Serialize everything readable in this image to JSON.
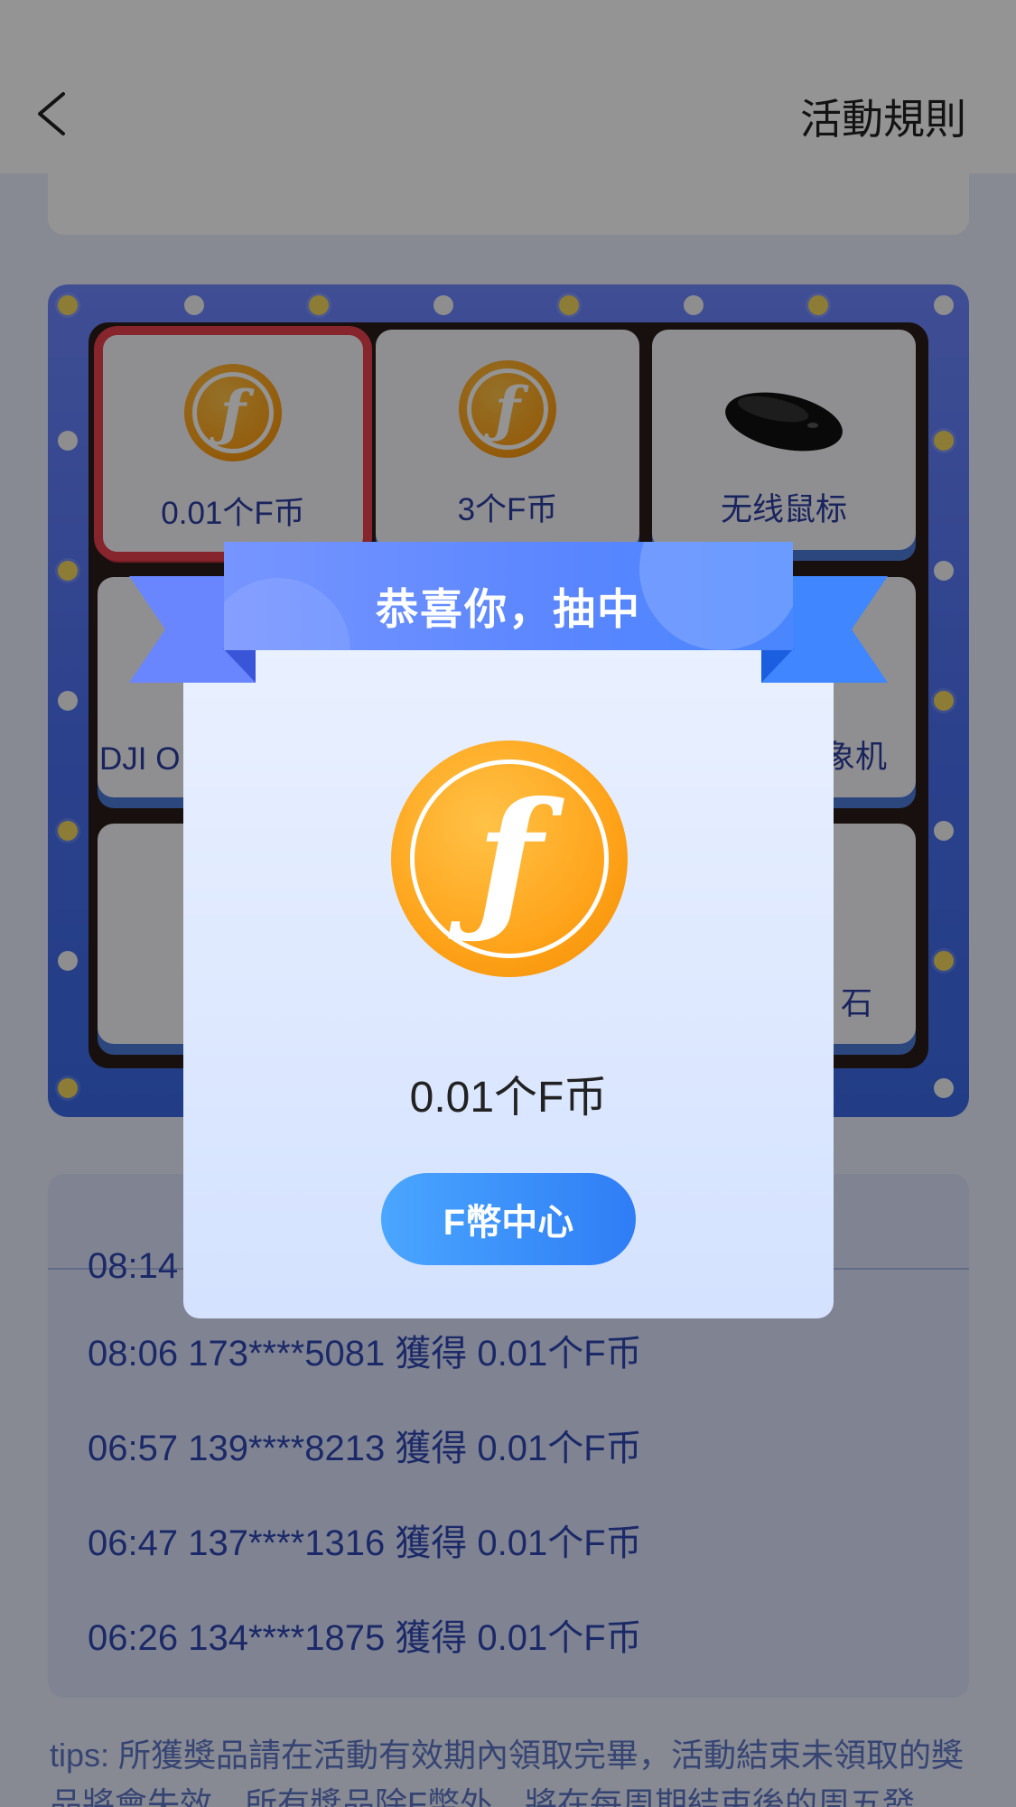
{
  "nav": {
    "rules_label": "活動規則"
  },
  "board": {
    "prizes": [
      {
        "label": "0.01个F币",
        "icon": "coin-icon",
        "active": true
      },
      {
        "label": "3个F币",
        "icon": "coin-icon"
      },
      {
        "label": "无线鼠标",
        "icon": "mouse-icon"
      },
      {
        "label": "DJI O",
        "icon": ""
      },
      {
        "label": "象机",
        "icon": ""
      },
      {
        "label": "",
        "icon": ""
      },
      {
        "label": "",
        "icon": ""
      },
      {
        "label": "石",
        "icon": ""
      }
    ],
    "coin_symbol": "ƒ"
  },
  "records": {
    "partial_top": "08:14",
    "rows": [
      "08:06 173****5081 獲得 0.01个F币",
      "06:57 139****8213 獲得 0.01个F币",
      "06:47 137****1316 獲得 0.01个F币",
      "06:26 134****1875 獲得 0.01个F币"
    ]
  },
  "tips": {
    "text": "tips: 所獲獎品請在活動有效期內領取完畢，活動結束未領取的獎品將會失效，所有獎品除F幣外，將在每周期結束後的周五發"
  },
  "modal": {
    "title": "恭喜你，抽中",
    "prize_name": "0.01个F币",
    "button_label": "F幣中心"
  },
  "colors": {
    "accent": "#4a86ff",
    "active_border": "#e8404c",
    "coin": "#ffa31a",
    "record_text": "#2f47b3"
  }
}
